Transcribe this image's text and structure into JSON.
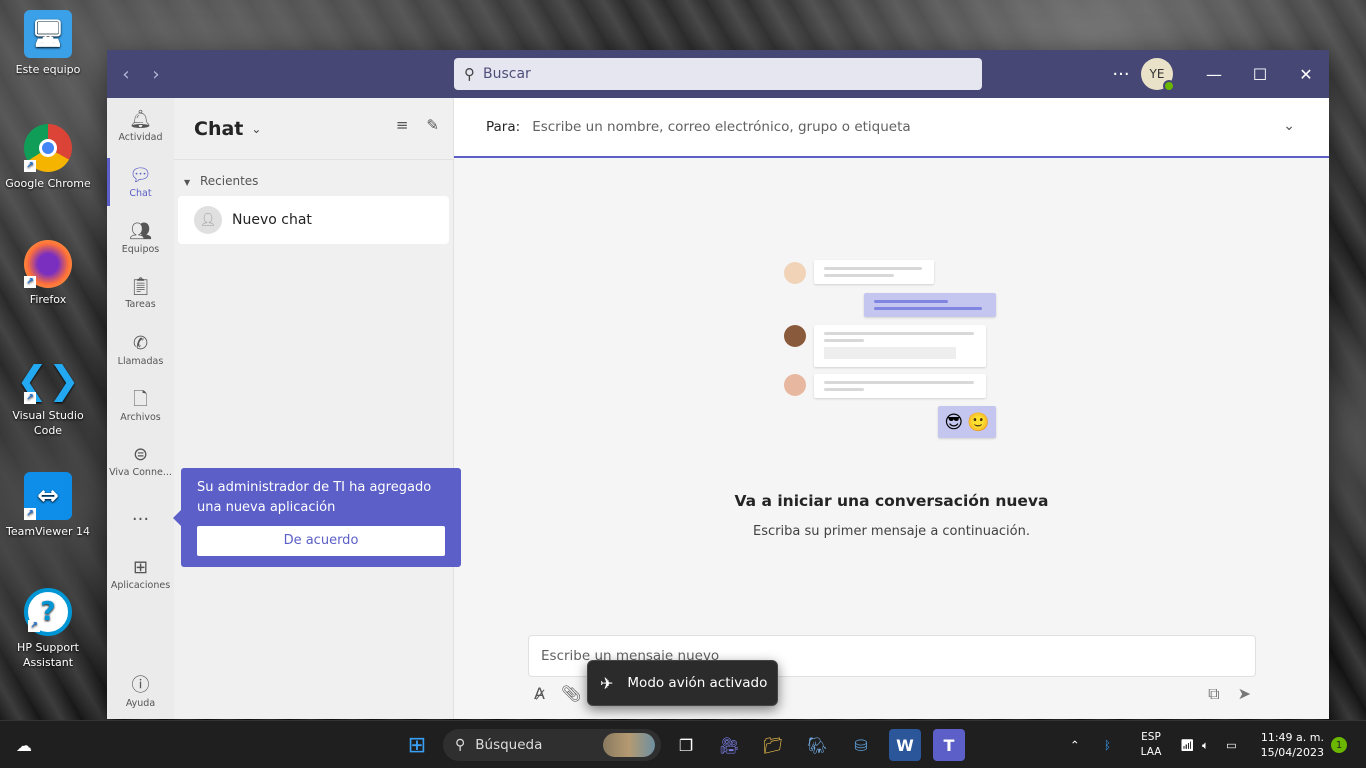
{
  "desktop": {
    "icons": [
      {
        "label": "Este equipo"
      },
      {
        "label": "Google Chrome"
      },
      {
        "label": "Firefox"
      },
      {
        "label": "Visual Studio Code"
      },
      {
        "label": "TeamViewer 14"
      },
      {
        "label": "HP Support Assistant"
      }
    ]
  },
  "titlebar": {
    "search_placeholder": "Buscar",
    "more_label": "···",
    "avatar_initials": "YE"
  },
  "rail": {
    "items": [
      {
        "label": "Actividad",
        "icon": "bell-icon"
      },
      {
        "label": "Chat",
        "icon": "chat-icon"
      },
      {
        "label": "Equipos",
        "icon": "teams-icon"
      },
      {
        "label": "Tareas",
        "icon": "tasks-icon"
      },
      {
        "label": "Llamadas",
        "icon": "phone-icon"
      },
      {
        "label": "Archivos",
        "icon": "file-icon"
      },
      {
        "label": "Viva Conne...",
        "icon": "viva-icon"
      },
      {
        "label": "···",
        "icon": "more-icon"
      },
      {
        "label": "Aplicaciones",
        "icon": "apps-icon"
      },
      {
        "label": "Ayuda",
        "icon": "help-icon"
      }
    ]
  },
  "chatpane": {
    "title": "Chat",
    "section": "Recientes",
    "items": [
      {
        "name": "Nuevo chat"
      }
    ]
  },
  "main": {
    "to_label": "Para:",
    "to_placeholder": "Escribe un nombre, correo electrónico, grupo o etiqueta",
    "empty_title": "Va a iniciar una conversación nueva",
    "empty_subtitle": "Escriba su primer mensaje a continuación.",
    "compose_placeholder": "Escribe un mensaje nuevo"
  },
  "popup": {
    "message": "Su administrador de TI ha agregado una nueva aplicación",
    "button": "De acuerdo"
  },
  "toast": {
    "message": "Modo avión activado"
  },
  "taskbar": {
    "search_label": "Búsqueda",
    "lang_top": "ESP",
    "lang_bottom": "LAA",
    "time": "11:49 a. m.",
    "date": "15/04/2023",
    "notifications": "1"
  },
  "colors": {
    "teams_purple": "#5b5fc7",
    "titlebar": "#464775",
    "presence": "#6bb700"
  }
}
